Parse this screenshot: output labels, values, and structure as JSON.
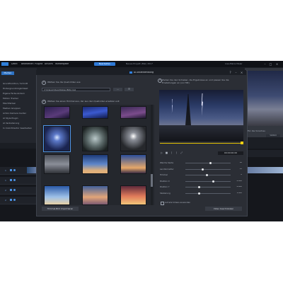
{
  "app": {
    "menu": [
      "Datei",
      "Bearbeiten",
      "Plugins",
      "Ansicht",
      "Wiedergabe"
    ],
    "mode_button": "Bearbeiten",
    "window_title": "Neues Projekt (Mai) 2017",
    "user_text": "Lisa-Marie Meier",
    "sidebar_tab": "Medien",
    "sidebar_items": [
      "Grundfunktion / Schnitt",
      "Hintergrundmöglichkeit",
      "Eigene Farbe ändern",
      "Motion Tracker",
      "Mischfarben",
      "Medien Gruppen",
      "Action Kamera Center",
      "AI Style Plugin",
      "AI Veränderung",
      "In ColorDirector bearbeiten"
    ],
    "preview_label": "Für die Vorschau",
    "preview_button": "Vollbild"
  },
  "dialog": {
    "title": "AI-Stilanwendung",
    "step1_num": "1",
    "step1_text": "Wählen Sie die Quell-Video aus:",
    "path": "C:\\Videos\\Videos\\Wolken\\Blitz.mp4",
    "browse": "...",
    "options": "☰",
    "step2_num": "2",
    "step2_text": "Wählen Sie einen Himmel aus, der aus den Quellvideo ersetzen soll:",
    "thumbs": [
      {
        "bg": "linear-gradient(160deg,#2b1f4e,#5a3b7a 60%,#1a1430)"
      },
      {
        "bg": "linear-gradient(170deg,#1d2a72,#3b5ad0 50%,#101a4a)"
      },
      {
        "bg": "linear-gradient(170deg,#3a2a55,#7b4c8c 60%,#1f1830)"
      },
      {
        "bg": "radial-gradient(circle at 50% 45%,#d7e6ff 0%,#5c79c9 20%,#1a2450 70%)",
        "selected": true
      },
      {
        "bg": "radial-gradient(circle at 50% 50%,#b9c8c9,#5c6a6a 45%,#1c2222 85%)"
      },
      {
        "bg": "radial-gradient(circle at 50% 40%,#ffffff 0%,#8b8f98 20%,#26282c 70%)"
      },
      {
        "bg": "linear-gradient(180deg,#4a4d56,#8a8e98 50%,#2f3238)"
      },
      {
        "bg": "linear-gradient(180deg,#1c3a78,#5d86c9 50%,#e1b07a 85%)"
      },
      {
        "bg": "linear-gradient(180deg,#2c4f9a,#e6a86a 70%,#3a2c44)"
      },
      {
        "bg": "linear-gradient(180deg,#2b5aa8,#9fc1e8 60%,#e7d0a4)"
      },
      {
        "bg": "linear-gradient(180deg,#44619a,#e2a579 60%,#7b5a72)"
      },
      {
        "bg": "linear-gradient(180deg,#5f2a3b,#e07a5a 55%,#f2c67a)"
      }
    ],
    "more_button": "Himmel-Bild importieren",
    "step3_num": "3",
    "step3_text": "Ziehen Sie den Schieber, die Ergebnisse an und passen Sie die Einstellungen an (vor Mit)",
    "timecode": "00:00:00:00",
    "params": [
      {
        "label": "Weiche Kante",
        "value": "10",
        "pos": 0.55
      },
      {
        "label": "Landkorrektur",
        "value": "15",
        "pos": 0.38
      },
      {
        "label": "Himmel",
        "value": "0",
        "pos": 0.48
      },
      {
        "label": "Position X",
        "value": "0.000",
        "pos": 0.62
      },
      {
        "label": "Position Y",
        "value": "0.000",
        "pos": 0.3
      },
      {
        "label": "Skalierung",
        "value": "1.000",
        "pos": 0.3
      }
    ],
    "apply_all_label": "Auf alle Videos anwenden",
    "apply_button": "Video beschränken"
  }
}
